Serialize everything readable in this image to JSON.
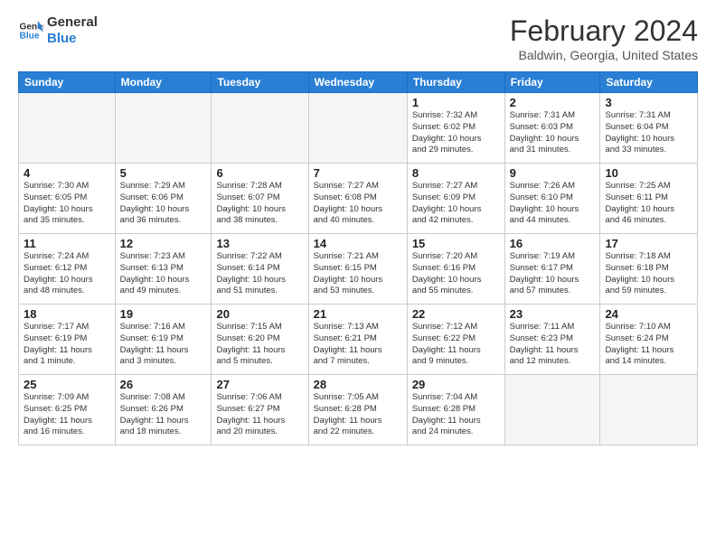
{
  "logo": {
    "line1": "General",
    "line2": "Blue"
  },
  "title": "February 2024",
  "location": "Baldwin, Georgia, United States",
  "days_header": [
    "Sunday",
    "Monday",
    "Tuesday",
    "Wednesday",
    "Thursday",
    "Friday",
    "Saturday"
  ],
  "weeks": [
    [
      {
        "day": "",
        "info": ""
      },
      {
        "day": "",
        "info": ""
      },
      {
        "day": "",
        "info": ""
      },
      {
        "day": "",
        "info": ""
      },
      {
        "day": "1",
        "info": "Sunrise: 7:32 AM\nSunset: 6:02 PM\nDaylight: 10 hours\nand 29 minutes."
      },
      {
        "day": "2",
        "info": "Sunrise: 7:31 AM\nSunset: 6:03 PM\nDaylight: 10 hours\nand 31 minutes."
      },
      {
        "day": "3",
        "info": "Sunrise: 7:31 AM\nSunset: 6:04 PM\nDaylight: 10 hours\nand 33 minutes."
      }
    ],
    [
      {
        "day": "4",
        "info": "Sunrise: 7:30 AM\nSunset: 6:05 PM\nDaylight: 10 hours\nand 35 minutes."
      },
      {
        "day": "5",
        "info": "Sunrise: 7:29 AM\nSunset: 6:06 PM\nDaylight: 10 hours\nand 36 minutes."
      },
      {
        "day": "6",
        "info": "Sunrise: 7:28 AM\nSunset: 6:07 PM\nDaylight: 10 hours\nand 38 minutes."
      },
      {
        "day": "7",
        "info": "Sunrise: 7:27 AM\nSunset: 6:08 PM\nDaylight: 10 hours\nand 40 minutes."
      },
      {
        "day": "8",
        "info": "Sunrise: 7:27 AM\nSunset: 6:09 PM\nDaylight: 10 hours\nand 42 minutes."
      },
      {
        "day": "9",
        "info": "Sunrise: 7:26 AM\nSunset: 6:10 PM\nDaylight: 10 hours\nand 44 minutes."
      },
      {
        "day": "10",
        "info": "Sunrise: 7:25 AM\nSunset: 6:11 PM\nDaylight: 10 hours\nand 46 minutes."
      }
    ],
    [
      {
        "day": "11",
        "info": "Sunrise: 7:24 AM\nSunset: 6:12 PM\nDaylight: 10 hours\nand 48 minutes."
      },
      {
        "day": "12",
        "info": "Sunrise: 7:23 AM\nSunset: 6:13 PM\nDaylight: 10 hours\nand 49 minutes."
      },
      {
        "day": "13",
        "info": "Sunrise: 7:22 AM\nSunset: 6:14 PM\nDaylight: 10 hours\nand 51 minutes."
      },
      {
        "day": "14",
        "info": "Sunrise: 7:21 AM\nSunset: 6:15 PM\nDaylight: 10 hours\nand 53 minutes."
      },
      {
        "day": "15",
        "info": "Sunrise: 7:20 AM\nSunset: 6:16 PM\nDaylight: 10 hours\nand 55 minutes."
      },
      {
        "day": "16",
        "info": "Sunrise: 7:19 AM\nSunset: 6:17 PM\nDaylight: 10 hours\nand 57 minutes."
      },
      {
        "day": "17",
        "info": "Sunrise: 7:18 AM\nSunset: 6:18 PM\nDaylight: 10 hours\nand 59 minutes."
      }
    ],
    [
      {
        "day": "18",
        "info": "Sunrise: 7:17 AM\nSunset: 6:19 PM\nDaylight: 11 hours\nand 1 minute."
      },
      {
        "day": "19",
        "info": "Sunrise: 7:16 AM\nSunset: 6:19 PM\nDaylight: 11 hours\nand 3 minutes."
      },
      {
        "day": "20",
        "info": "Sunrise: 7:15 AM\nSunset: 6:20 PM\nDaylight: 11 hours\nand 5 minutes."
      },
      {
        "day": "21",
        "info": "Sunrise: 7:13 AM\nSunset: 6:21 PM\nDaylight: 11 hours\nand 7 minutes."
      },
      {
        "day": "22",
        "info": "Sunrise: 7:12 AM\nSunset: 6:22 PM\nDaylight: 11 hours\nand 9 minutes."
      },
      {
        "day": "23",
        "info": "Sunrise: 7:11 AM\nSunset: 6:23 PM\nDaylight: 11 hours\nand 12 minutes."
      },
      {
        "day": "24",
        "info": "Sunrise: 7:10 AM\nSunset: 6:24 PM\nDaylight: 11 hours\nand 14 minutes."
      }
    ],
    [
      {
        "day": "25",
        "info": "Sunrise: 7:09 AM\nSunset: 6:25 PM\nDaylight: 11 hours\nand 16 minutes."
      },
      {
        "day": "26",
        "info": "Sunrise: 7:08 AM\nSunset: 6:26 PM\nDaylight: 11 hours\nand 18 minutes."
      },
      {
        "day": "27",
        "info": "Sunrise: 7:06 AM\nSunset: 6:27 PM\nDaylight: 11 hours\nand 20 minutes."
      },
      {
        "day": "28",
        "info": "Sunrise: 7:05 AM\nSunset: 6:28 PM\nDaylight: 11 hours\nand 22 minutes."
      },
      {
        "day": "29",
        "info": "Sunrise: 7:04 AM\nSunset: 6:28 PM\nDaylight: 11 hours\nand 24 minutes."
      },
      {
        "day": "",
        "info": ""
      },
      {
        "day": "",
        "info": ""
      }
    ]
  ]
}
